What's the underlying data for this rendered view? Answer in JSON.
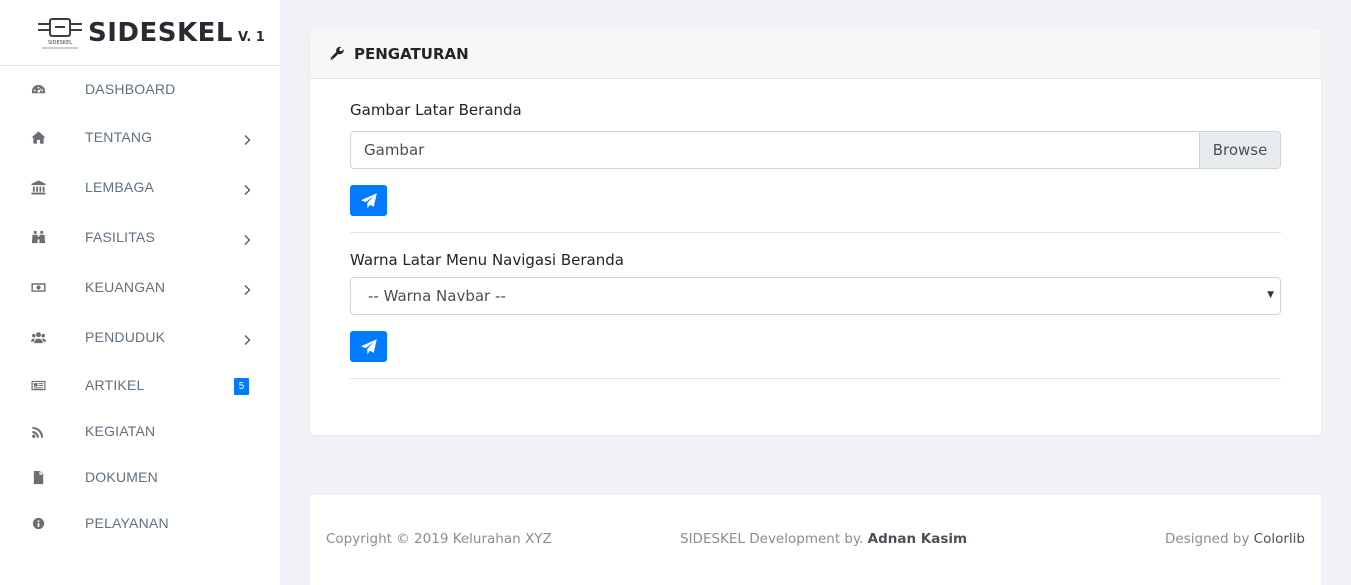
{
  "brand": {
    "logo_icon": "sideskel-logo-icon",
    "logo_small_text": "SIDESKEL",
    "title": "SIDESKEL",
    "version": "V. 1"
  },
  "sidebar": {
    "items": [
      {
        "label": "DASHBOARD",
        "icon": "dashboard-icon",
        "has_submenu": false
      },
      {
        "label": "TENTANG",
        "icon": "home-icon",
        "has_submenu": true
      },
      {
        "label": "LEMBAGA",
        "icon": "institution-icon",
        "has_submenu": true
      },
      {
        "label": "FASILITAS",
        "icon": "binoculars-icon",
        "has_submenu": true
      },
      {
        "label": "KEUANGAN",
        "icon": "money-icon",
        "has_submenu": true
      },
      {
        "label": "PENDUDUK",
        "icon": "users-icon",
        "has_submenu": true
      },
      {
        "label": "ARTIKEL",
        "icon": "newspaper-icon",
        "has_submenu": false,
        "badge": "5"
      },
      {
        "label": "KEGIATAN",
        "icon": "rss-icon",
        "has_submenu": false
      },
      {
        "label": "DOKUMEN",
        "icon": "file-icon",
        "has_submenu": false
      },
      {
        "label": "PELAYANAN",
        "icon": "info-icon",
        "has_submenu": false
      }
    ]
  },
  "card": {
    "title": "PENGATURAN",
    "header_icon": "wrench-icon",
    "image_section": {
      "label": "Gambar Latar Beranda",
      "file_placeholder": "Gambar",
      "browse_label": "Browse",
      "submit_icon": "paper-plane-icon"
    },
    "navbar_section": {
      "label": "Warna Latar Menu Navigasi Beranda",
      "select_value": "-- Warna Navbar --",
      "submit_icon": "paper-plane-icon"
    }
  },
  "footer": {
    "copyright": "Copyright © 2019 Kelurahan XYZ",
    "dev_prefix": "SIDESKEL Development by.",
    "dev_name": "Adnan Kasim",
    "designed_prefix": "Designed by",
    "designed_link": "Colorlib"
  },
  "colors": {
    "accent": "#007bff",
    "page_bg": "#f1f2f7",
    "menu_text": "#607080"
  }
}
